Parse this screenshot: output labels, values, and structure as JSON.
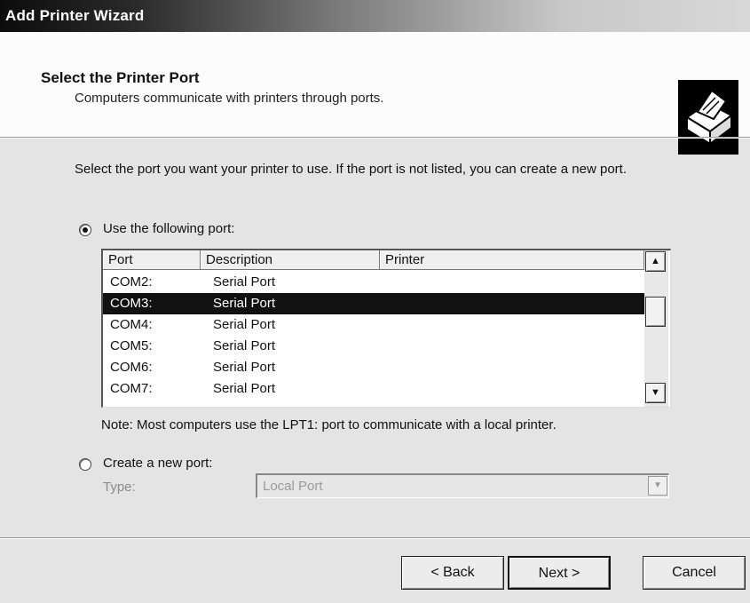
{
  "window": {
    "title": "Add Printer Wizard"
  },
  "header": {
    "title": "Select the Printer Port",
    "subtitle": "Computers communicate with printers through ports.",
    "icon": "printer-icon"
  },
  "intro": "Select the port you want your printer to use.  If the port is not listed, you can create a new port.",
  "use_port": {
    "label": "Use the following port:",
    "selected": true,
    "columns": [
      "Port",
      "Description",
      "Printer"
    ],
    "rows": [
      {
        "port": "COM2:",
        "description": "Serial Port",
        "printer": ""
      },
      {
        "port": "COM3:",
        "description": "Serial Port",
        "printer": ""
      },
      {
        "port": "COM4:",
        "description": "Serial Port",
        "printer": ""
      },
      {
        "port": "COM5:",
        "description": "Serial Port",
        "printer": ""
      },
      {
        "port": "COM6:",
        "description": "Serial Port",
        "printer": ""
      },
      {
        "port": "COM7:",
        "description": "Serial Port",
        "printer": ""
      }
    ],
    "selected_port": "COM3:"
  },
  "note": "Note: Most computers use the LPT1: port to communicate with a local printer.",
  "new_port": {
    "label": "Create a new port:",
    "selected": false,
    "type_label": "Type:",
    "type_value": "Local Port"
  },
  "buttons": {
    "back": "< Back",
    "next": "Next >",
    "cancel": "Cancel"
  }
}
